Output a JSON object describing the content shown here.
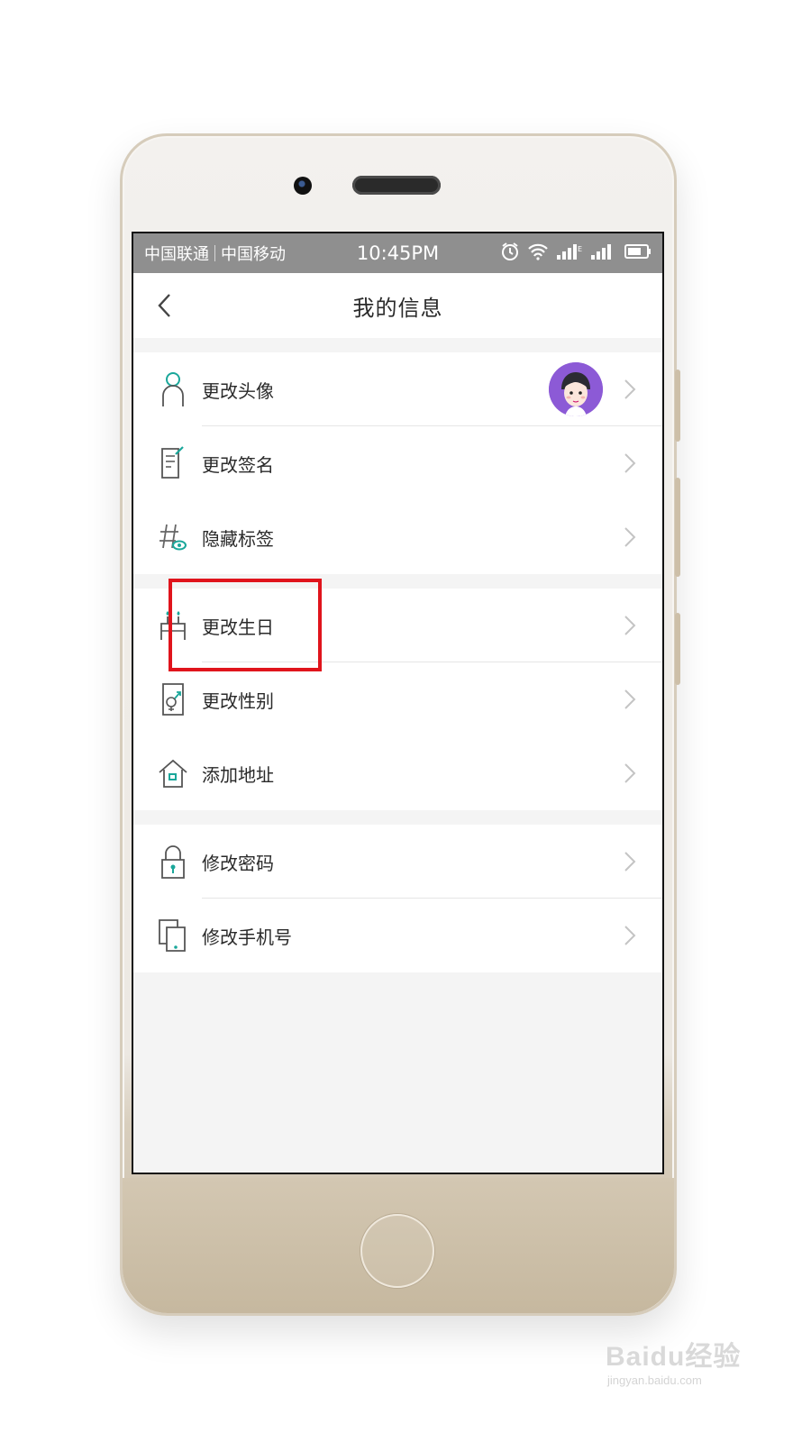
{
  "statusbar": {
    "carrier1": "中国联通",
    "carrier2": "中国移动",
    "time": "10:45PM"
  },
  "header": {
    "title": "我的信息"
  },
  "groups": [
    {
      "items": [
        {
          "label": "更改头像",
          "icon": "person-icon",
          "has_avatar": true
        },
        {
          "label": "更改签名",
          "icon": "signature-icon"
        },
        {
          "label": "隐藏标签",
          "icon": "hidden-tag-icon"
        }
      ]
    },
    {
      "items": [
        {
          "label": "更改生日",
          "icon": "birthday-icon",
          "highlighted": true
        },
        {
          "label": "更改性别",
          "icon": "gender-icon"
        },
        {
          "label": "添加地址",
          "icon": "address-icon"
        }
      ]
    },
    {
      "items": [
        {
          "label": "修改密码",
          "icon": "lock-icon"
        },
        {
          "label": "修改手机号",
          "icon": "phone-number-icon"
        }
      ]
    }
  ],
  "highlight_color": "#e0141c",
  "accent_color": "#1aa79a",
  "watermark": {
    "main": "Baidu经验",
    "sub": "jingyan.baidu.com"
  }
}
